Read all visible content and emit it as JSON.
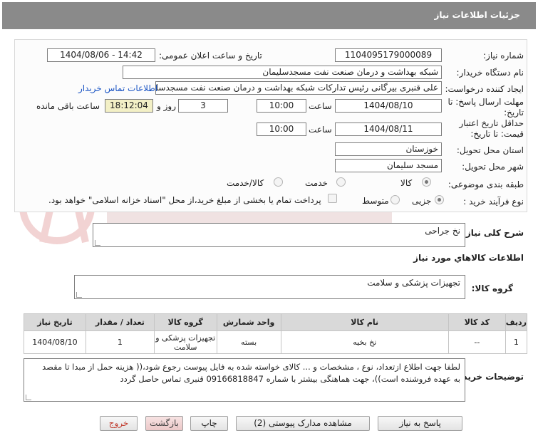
{
  "header": {
    "title": "جزئیات اطلاعات نیاز"
  },
  "form": {
    "need_number_label": "شماره نیاز:",
    "need_number": "1104095179000089",
    "announce_label": "تاریخ و ساعت اعلان عمومی:",
    "announce_value": "1404/08/06 - 14:42",
    "buyer_org_label": "نام دستگاه خریدار:",
    "buyer_org": "شبکه بهداشت و درمان صنعت نفت مسجدسلیمان",
    "creator_label": "ایجاد کننده درخواست:",
    "creator": "علی قنبری بیرگانی رئیس تدارکات شبکه بهداشت و درمان صنعت نفت مسجدسلیمان",
    "contact_link": "اطلاعات تماس خریدار",
    "deadline_label_1": "مهلت ارسال پاسخ: تا",
    "deadline_label_2": "تاریخ:",
    "deadline_date": "1404/08/10",
    "time_label": "ساعت",
    "deadline_time": "10:00",
    "days_value": "3",
    "days_label": "روز و",
    "remaining_time": "18:12:04",
    "remaining_label": "ساعت باقی مانده",
    "validity_label_1": "حداقل تاریخ اعتبار",
    "validity_label_2": "قیمت: تا تاریخ:",
    "validity_date": "1404/08/11",
    "validity_time_label": "ساعت",
    "validity_time": "10:00",
    "province_label": "استان محل تحویل:",
    "province": "خوزستان",
    "city_label": "شهر محل تحویل:",
    "city": "مسجد سلیمان",
    "category_label": "طبقه بندی موضوعی:",
    "category_options": [
      "کالا",
      "خدمت",
      "کالا/خدمت"
    ],
    "process_label": "نوع فرآیند خرید :",
    "process_options": [
      "جزیی",
      "متوسط"
    ],
    "payment_note": "پرداخت تمام یا بخشی از مبلغ خرید،از محل \"اسناد خزانه اسلامی\" خواهد بود."
  },
  "description": {
    "label": "شرح کلی نیاز:",
    "value": "نخ جراحی"
  },
  "goods": {
    "section_title": "اطلاعات کالاهاي مورد نیاز",
    "group_label": "گروه کالا:",
    "group_value": "تجهیزات پزشکی و سلامت"
  },
  "table": {
    "headers": [
      "ردیف",
      "کد کالا",
      "نام کالا",
      "واحد شمارش",
      "گروه کالا",
      "تعداد / مقدار",
      "تاریخ نیاز"
    ],
    "rows": [
      [
        "1",
        "--",
        "نخ بخیه",
        "بسته",
        "تجهیزات پزشکی و سلامت",
        "1",
        "1404/08/10"
      ]
    ]
  },
  "buyer_notes": {
    "label": "توضیحات خریدار:",
    "line1": "لطفا جهت اطلاع ازتعداد،  نوع ، مشخصات و ... کالای خواسته شده به فایل پیوست رجوع شود،(( هزینه حمل از مبدا تا مقصد",
    "line2": "به عهده فروشنده است))، جهت هماهنگی بیشتر با شماره 09166818847 قنبری تماس حاصل گردد"
  },
  "buttons": {
    "reply": "پاسخ به نیاز",
    "attachments": "مشاهده مدارک پیوستی (2)",
    "print": "چاپ",
    "back": "بازگشت",
    "exit": "خروج"
  },
  "colors": {
    "header_bg": "#8a8a8a",
    "link": "#1b55c4",
    "remaining_bg": "#f3f0c6",
    "table_header_bg": "#d9d9d9"
  }
}
